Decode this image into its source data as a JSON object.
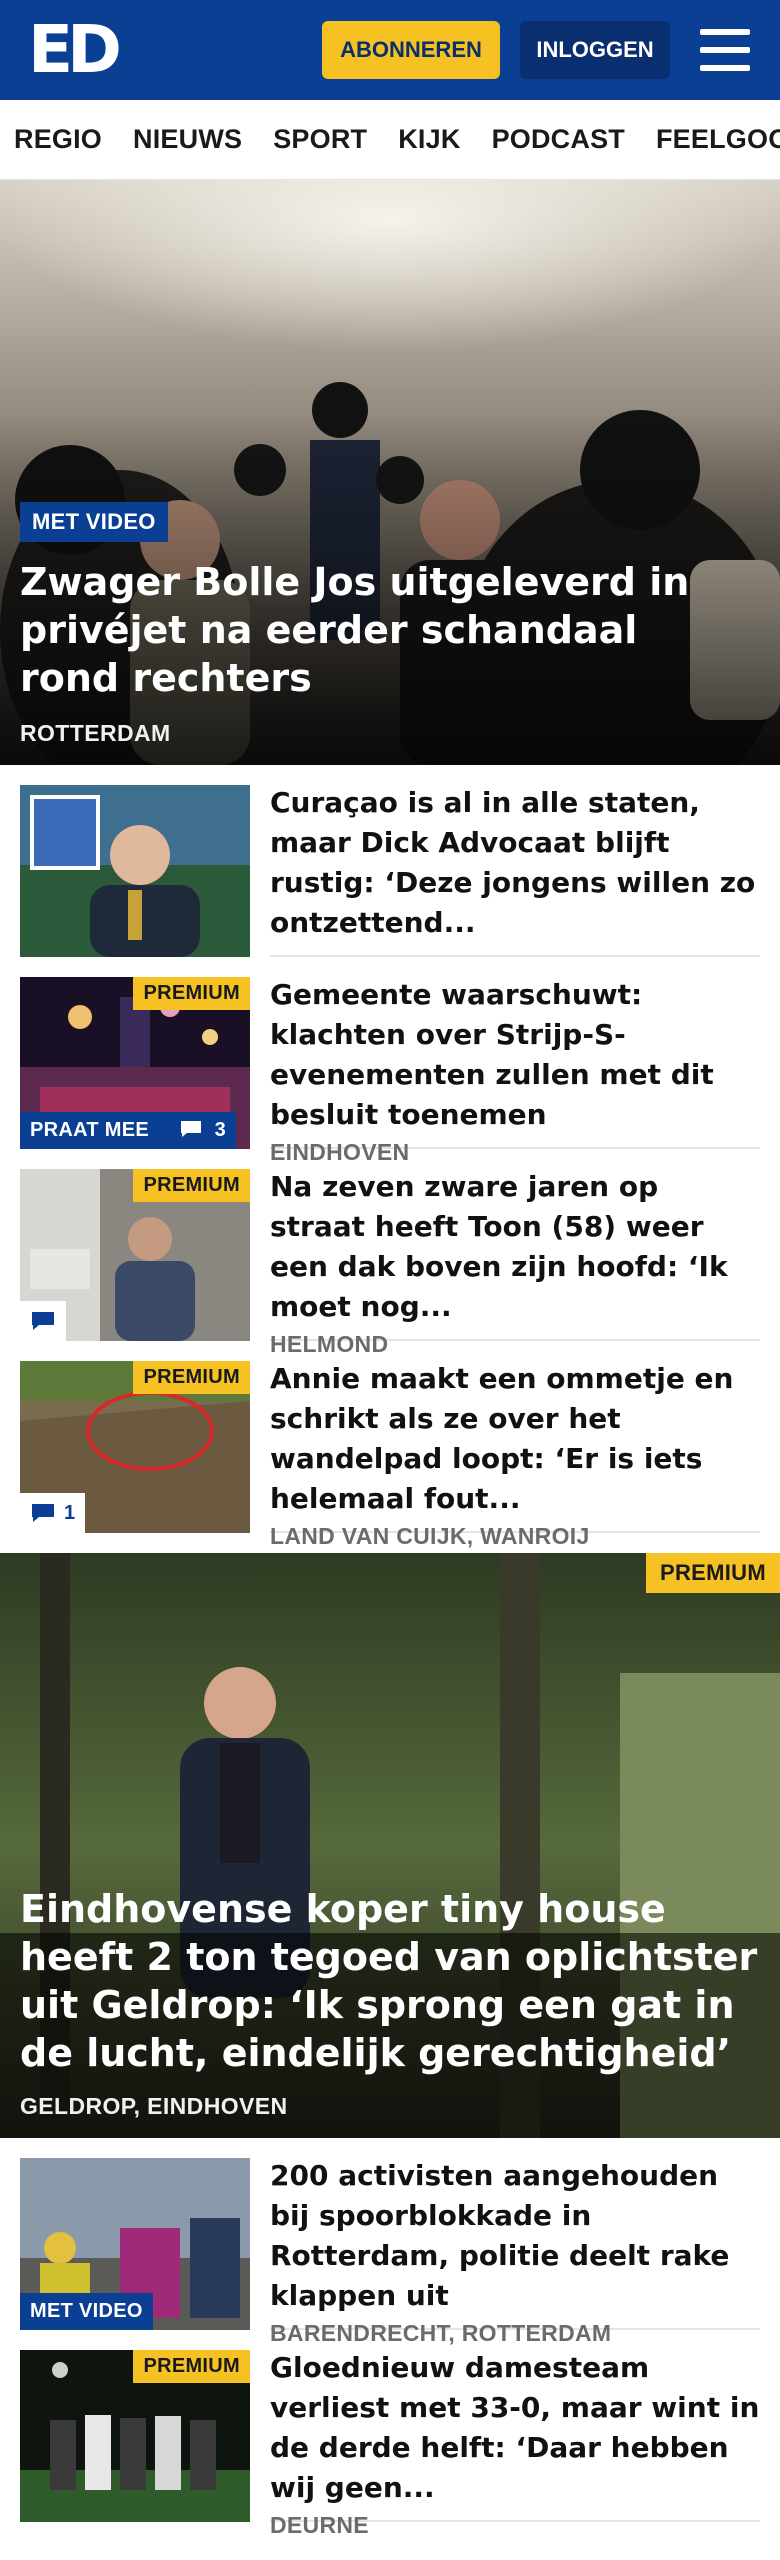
{
  "header": {
    "logo": "ED",
    "subscribe_label": "ABONNEREN",
    "login_label": "INLOGGEN",
    "menu_icon": "hamburger-menu-icon",
    "brand_color": "#0b3f94",
    "accent_color": "#f6c223"
  },
  "nav": {
    "items": [
      "REGIO",
      "NIEUWS",
      "SPORT",
      "KIJK",
      "PODCAST",
      "FEELGOOD"
    ]
  },
  "hero": {
    "badge": "MET VIDEO",
    "title": "Zwager Bolle Jos uitgeleverd in privéjet na eerder schandaal rond rechters",
    "location": "ROTTERDAM"
  },
  "articles": [
    {
      "title": "Curaçao is al in alle staten, maar Dick Advocaat blijft rustig: ‘Deze jongens willen zo ontzettend...",
      "location": ""
    },
    {
      "premium": "PREMIUM",
      "praat": "PRAAT MEE",
      "comments": "3",
      "title": "Gemeente waarschuwt: klachten over Strijp-S-evenementen zullen met dit besluit toenemen",
      "location": "EINDHOVEN"
    },
    {
      "premium": "PREMIUM",
      "title": "Na zeven zware jaren op straat heeft Toon (58) weer een dak boven zijn hoofd: ‘Ik moet nog...",
      "location": "HELMOND"
    },
    {
      "premium": "PREMIUM",
      "comments": "1",
      "title": "Annie maakt een ommetje en schrikt als ze over het wandelpad loopt: ‘Er is iets helemaal fout...",
      "location": "LAND VAN CUIJK, WANROIJ"
    }
  ],
  "feature": {
    "premium": "PREMIUM",
    "title": "Eindhovense koper tiny house heeft 2 ton tegoed van oplichtster uit Geldrop: ‘Ik sprong een gat in de lucht, eindelijk gerechtigheid’",
    "location": "GELDROP, EINDHOVEN"
  },
  "articles2": [
    {
      "badge": "MET VIDEO",
      "title": "200 activisten aangehouden bij spoorblokkade in Rotterdam, politie deelt rake klappen uit",
      "location": "BARENDRECHT, ROTTERDAM"
    },
    {
      "premium": "PREMIUM",
      "title": "Gloednieuw damesteam verliest met 33-0, maar wint in de derde helft: ‘Daar hebben wij geen...",
      "location": "DEURNE"
    }
  ]
}
